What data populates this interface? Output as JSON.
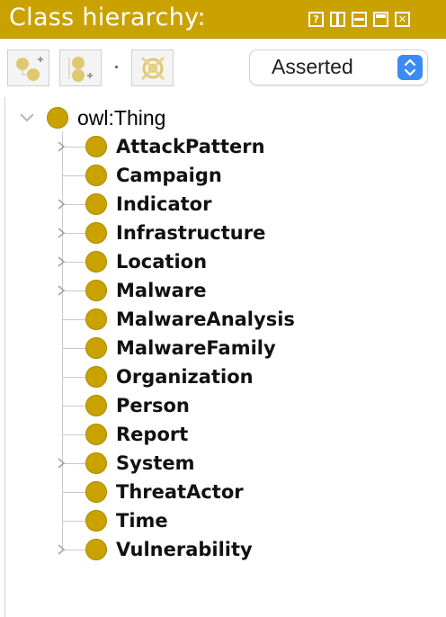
{
  "panel": {
    "title": "Class hierarchy:",
    "window_buttons": [
      "?",
      "split",
      "minimize",
      "maximize",
      "close"
    ]
  },
  "toolbar": {
    "buttons": [
      {
        "name": "add-subclass-icon"
      },
      {
        "name": "add-sibling-class-icon"
      },
      {
        "name": "delete-class-icon"
      }
    ],
    "view_select": {
      "selected": "Asserted"
    }
  },
  "colors": {
    "accent": "#c9a200",
    "select_blue": "#3b8bf3",
    "tree_line": "#c9c9c9"
  },
  "tree": {
    "root": {
      "label": "owl:Thing",
      "expanded": true
    },
    "children": [
      {
        "label": "AttackPattern",
        "has_children": true
      },
      {
        "label": "Campaign",
        "has_children": false
      },
      {
        "label": "Indicator",
        "has_children": true
      },
      {
        "label": "Infrastructure",
        "has_children": true
      },
      {
        "label": "Location",
        "has_children": true
      },
      {
        "label": "Malware",
        "has_children": true
      },
      {
        "label": "MalwareAnalysis",
        "has_children": false
      },
      {
        "label": "MalwareFamily",
        "has_children": false
      },
      {
        "label": "Organization",
        "has_children": false
      },
      {
        "label": "Person",
        "has_children": false
      },
      {
        "label": "Report",
        "has_children": false
      },
      {
        "label": "System",
        "has_children": true
      },
      {
        "label": "ThreatActor",
        "has_children": false
      },
      {
        "label": "Time",
        "has_children": false
      },
      {
        "label": "Vulnerability",
        "has_children": true
      }
    ]
  }
}
